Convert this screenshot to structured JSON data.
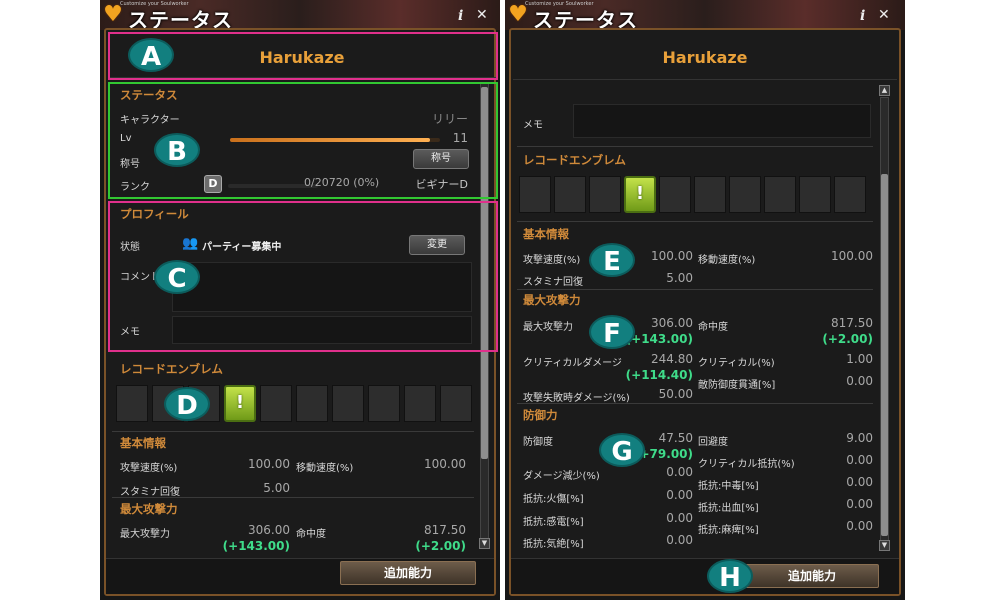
{
  "window_header": {
    "title": "ステータス",
    "subtitle": "Customize your Soulworker",
    "info": "i",
    "close": "✕"
  },
  "character": {
    "name": "Harukaze"
  },
  "status": {
    "section": "ステータス",
    "character_label": "キャラクター",
    "character_value": "リリー",
    "lv_label": "Lv",
    "lv_value": "11",
    "lv_progress": 0.95,
    "title_label": "称号",
    "title_button": "称号",
    "rank_label": "ランク",
    "rank_badge": "D",
    "rank_exp": "0/20720 (0%)",
    "rank_name": "ビギナーD"
  },
  "profile": {
    "section": "プロフィール",
    "state_label": "状態",
    "state_value": "パーティー募集中",
    "change_button": "変更",
    "comment_label": "コメント",
    "memo_label": "メモ"
  },
  "emblem": {
    "section": "レコードエンブレム",
    "symbol": "!"
  },
  "basic_info": {
    "section": "基本情報",
    "attack_speed_label": "攻撃速度(%)",
    "attack_speed": "100.00",
    "move_speed_label": "移動速度(%)",
    "move_speed": "100.00",
    "stamina_label": "スタミナ回復",
    "stamina": "5.00"
  },
  "max_attack": {
    "section": "最大攻撃力",
    "max_attack_label": "最大攻撃力",
    "max_attack": "306.00",
    "max_attack_bonus": "(+143.00)",
    "accuracy_label": "命中度",
    "accuracy": "817.50",
    "accuracy_bonus": "(+2.00)",
    "crit_damage_label": "クリティカルダメージ",
    "crit_damage": "244.80",
    "crit_damage_bonus": "(+114.40)",
    "crit_label": "クリティカル(%)",
    "crit": "1.00",
    "def_pierce_label": "敵防御度貫通[%]",
    "def_pierce": "0.00",
    "fail_damage_label": "攻撃失敗時ダメージ(%)",
    "fail_damage": "50.00"
  },
  "defense": {
    "section": "防御力",
    "defense_label": "防御度",
    "defense": "47.50",
    "defense_bonus": "(+79.00)",
    "evasion_label": "回避度",
    "evasion": "9.00",
    "dmg_reduce_label": "ダメージ減少(%)",
    "dmg_reduce": "0.00",
    "crit_resist_label": "クリティカル抵抗(%)",
    "crit_resist": "0.00",
    "res_fire_label": "抵抗:火傷[%]",
    "res_fire": "0.00",
    "res_poison_label": "抵抗:中毒[%]",
    "res_poison": "0.00",
    "res_shock_label": "抵抗:感電[%]",
    "res_shock": "0.00",
    "res_bleed_label": "抵抗:出血[%]",
    "res_bleed": "0.00",
    "res_faint_label": "抵抗:気絶[%]",
    "res_faint": "0.00",
    "res_paralysis_label": "抵抗:麻痺[%]",
    "res_paralysis": "0.00"
  },
  "footer": {
    "extra_button": "追加能力"
  },
  "annotations": {
    "A": "A",
    "B": "B",
    "C": "C",
    "D": "D",
    "E": "E",
    "F": "F",
    "G": "G",
    "H": "H"
  },
  "colors": {
    "accent": "#e8a03a",
    "bonus": "#3fdc8a",
    "box_a": "#e0308c",
    "box_b": "#32c832",
    "tag": "#127f7f"
  }
}
